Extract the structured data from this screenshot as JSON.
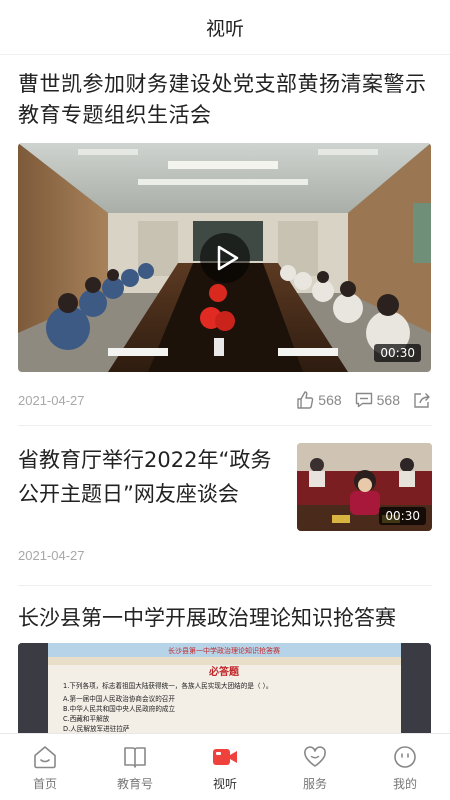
{
  "header": {
    "title": "视听"
  },
  "articles": [
    {
      "title": "曹世凯参加财务建设处党支部黄扬清案警示教育专题组织生活会",
      "duration": "00:30",
      "date": "2021-04-27",
      "likes": "568",
      "comments": "568",
      "icons": {
        "like": "thumbs-up-icon",
        "comment": "comment-icon",
        "share": "share-icon",
        "play": "play-icon"
      }
    },
    {
      "title": "省教育厅举行2022年“政务公开主题日”网友座谈会",
      "duration": "00:30",
      "date": "2021-04-27"
    },
    {
      "title": "长沙县第一中学开展政治理论知识抢答赛",
      "banner": "长沙县第一中学政治理论知识抢答赛",
      "quiz_heading": "必答题",
      "quiz_question": "1.下列各项，标志着祖国大陆获得统一，各族人民实现大团结的是（   ）。",
      "quiz_options": [
        "A.第一届中国人民政治协商会议的召开",
        "B.中华人民共和国中央人民政府的成立",
        "C.西藏和平解放",
        "D.人民解放军进驻拉萨"
      ]
    }
  ],
  "tabbar": {
    "active": "视听",
    "items": [
      {
        "label": "首页",
        "icon": "home-icon"
      },
      {
        "label": "教育号",
        "icon": "book-icon"
      },
      {
        "label": "视听",
        "icon": "video-camera-icon"
      },
      {
        "label": "服务",
        "icon": "heart-icon"
      },
      {
        "label": "我的",
        "icon": "profile-face-icon"
      }
    ]
  },
  "colors": {
    "accent": "#f0423c",
    "text": "#222222",
    "meta": "#a8a8a8",
    "tab_inactive": "#777777"
  }
}
